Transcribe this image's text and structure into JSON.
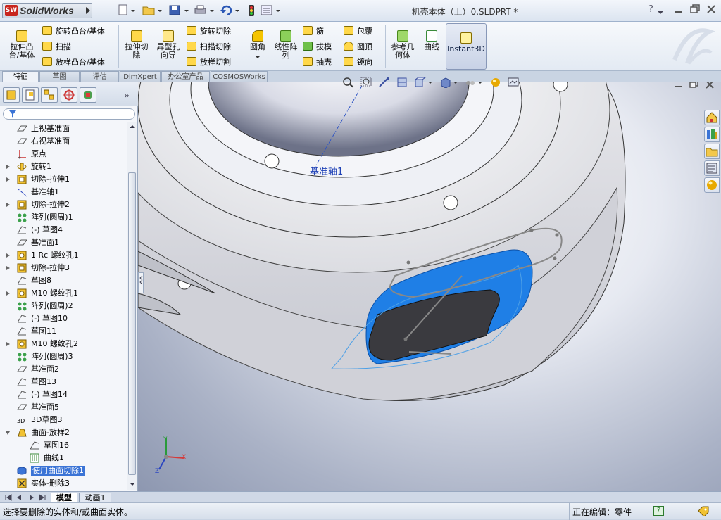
{
  "app": {
    "logo_text": "SolidWorks",
    "document_title": "机壳本体（上）0.SLDPRT *",
    "help_label": "?"
  },
  "quick_access": {
    "icons": [
      "new-document-icon",
      "open-folder-icon",
      "save-icon",
      "print-icon",
      "undo-icon",
      "rebuild-icon",
      "options-icon"
    ]
  },
  "command_manager": {
    "features": {
      "extrude_boss": "拉伸凸\n台/基体",
      "revolve_boss": "旋转凸台/基体",
      "swept_boss": "扫描",
      "loft_boss": "放样凸台/基体",
      "extrude_cut": "拉伸切\n除",
      "hole_wizard": "异型孔\n向导",
      "revolve_cut": "旋转切除",
      "swept_cut": "扫描切除",
      "loft_cut": "放样切割",
      "fillet": "圆角",
      "linear_pattern": "线性阵\n列",
      "rib": "筋",
      "draft": "拔模",
      "shell": "抽壳",
      "wrap": "包覆",
      "dome": "圆顶",
      "mirror": "镜向",
      "ref_geometry": "参考几\n何体",
      "curves": "曲线",
      "instant3d": "Instant3D"
    },
    "tabs": [
      "特征",
      "草图",
      "评估",
      "DimXpert",
      "办公室产品",
      "COSMOSWorks"
    ],
    "active_tab": "特征"
  },
  "feature_tree": {
    "items": [
      {
        "label": "上视基准面",
        "icon": "plane-icon",
        "expandable": false
      },
      {
        "label": "右视基准面",
        "icon": "plane-icon",
        "expandable": false
      },
      {
        "label": "原点",
        "icon": "origin-icon",
        "expandable": false
      },
      {
        "label": "旋转1",
        "icon": "revolve-icon",
        "expandable": true
      },
      {
        "label": "切除-拉伸1",
        "icon": "cut-extrude-icon",
        "expandable": true
      },
      {
        "label": "基准轴1",
        "icon": "axis-icon",
        "expandable": false
      },
      {
        "label": "切除-拉伸2",
        "icon": "cut-extrude-icon",
        "expandable": true
      },
      {
        "label": "阵列(圆周)1",
        "icon": "circular-pattern-icon",
        "expandable": false
      },
      {
        "label": "(-) 草图4",
        "icon": "sketch-icon",
        "expandable": false
      },
      {
        "label": "基准面1",
        "icon": "plane-icon",
        "expandable": false
      },
      {
        "label": "1 Rc 螺纹孔1",
        "icon": "hole-icon",
        "expandable": true
      },
      {
        "label": "切除-拉伸3",
        "icon": "cut-extrude-icon",
        "expandable": true
      },
      {
        "label": "草图8",
        "icon": "sketch-icon",
        "expandable": false
      },
      {
        "label": "M10 螺纹孔1",
        "icon": "hole-icon",
        "expandable": true
      },
      {
        "label": "阵列(圆周)2",
        "icon": "circular-pattern-icon",
        "expandable": false
      },
      {
        "label": "(-) 草图10",
        "icon": "sketch-icon",
        "expandable": false
      },
      {
        "label": "草图11",
        "icon": "sketch-icon",
        "expandable": false
      },
      {
        "label": "M10 螺纹孔2",
        "icon": "hole-icon",
        "expandable": true
      },
      {
        "label": "阵列(圆周)3",
        "icon": "circular-pattern-icon",
        "expandable": false
      },
      {
        "label": "基准面2",
        "icon": "plane-icon",
        "expandable": false
      },
      {
        "label": "草图13",
        "icon": "sketch-icon",
        "expandable": false
      },
      {
        "label": "(-) 草图14",
        "icon": "sketch-icon",
        "expandable": false
      },
      {
        "label": "基准面5",
        "icon": "plane-icon",
        "expandable": false
      },
      {
        "label": "3D草图3",
        "icon": "sketch3d-icon",
        "expandable": false
      },
      {
        "label": "曲面-放样2",
        "icon": "surface-loft-icon",
        "expandable": true,
        "open": true
      },
      {
        "label": "草图16",
        "icon": "sketch-icon",
        "expandable": false,
        "indent": 1
      },
      {
        "label": "曲线1",
        "icon": "curve-icon",
        "expandable": true,
        "indent": 1
      },
      {
        "label": "使用曲面切除1",
        "icon": "surface-cut-icon",
        "expandable": false,
        "selected": true
      },
      {
        "label": "实体-删除3",
        "icon": "delete-body-icon",
        "expandable": false
      }
    ]
  },
  "viewport": {
    "axis_label": "基准轴1",
    "triad": {
      "x": "X",
      "y": "Y",
      "z": "Z"
    }
  },
  "bottom_tabs": [
    "模型",
    "动画1"
  ],
  "active_bottom_tab": "模型",
  "status_bar": {
    "message": "选择要删除的实体和/或曲面实体。",
    "editing": "正在编辑：零件"
  },
  "colors": {
    "accent_blue": "#1f7fe6",
    "selected_bg": "#3b74d6",
    "part_gray": "#e7e7ea"
  }
}
